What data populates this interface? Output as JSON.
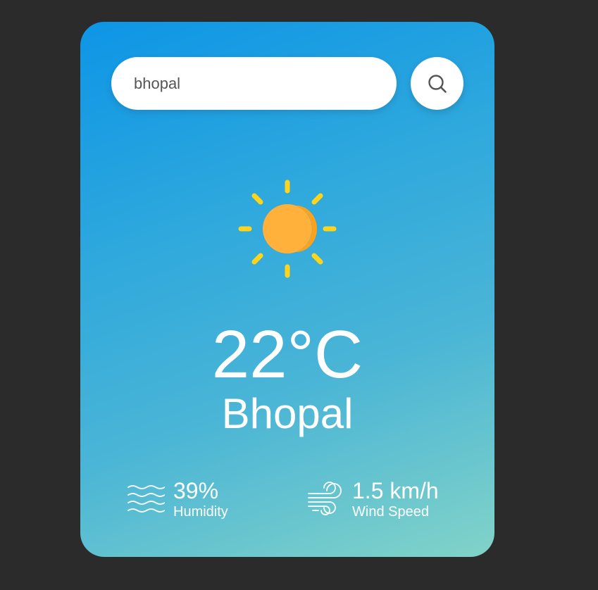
{
  "search": {
    "value": "bhopal",
    "button_icon": "search-icon"
  },
  "weather": {
    "icon": "sun-icon",
    "temperature": "22°C",
    "city": "Bhopal"
  },
  "details": {
    "humidity": {
      "icon": "humidity-icon",
      "value": "39%",
      "label": "Humidity"
    },
    "wind": {
      "icon": "wind-icon",
      "value": "1.5 km/h",
      "label": "Wind Speed"
    }
  },
  "colors": {
    "background": "#2b2b2b",
    "card_gradient_start": "#0d95e6",
    "card_gradient_end": "#82d3c8",
    "sun": "#ffb13b",
    "sun_rays": "#ffd41a",
    "text": "#ffffff"
  }
}
